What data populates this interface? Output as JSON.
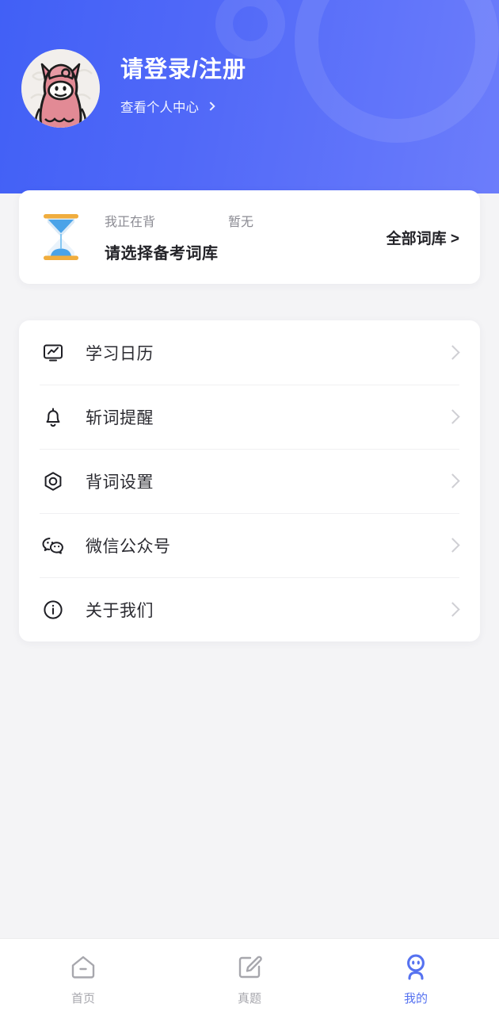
{
  "theme": {
    "header_gradient_from": "#4160f6",
    "header_gradient_to": "#6c7dfb",
    "page_background": "#f4f4f6",
    "card_background": "#ffffff",
    "accent": "#5672f0",
    "muted_text": "#8b8b93",
    "primary_text": "#232328",
    "chevron_grey": "#cfcfd4"
  },
  "header": {
    "avatar_name": "alpaca-avatar",
    "login_title": "请登录/注册",
    "profile_link_label": "查看个人中心",
    "profile_link_chevron": ">"
  },
  "wordbank": {
    "icon_name": "hourglass-icon",
    "status_label": "我正在背",
    "status_value": "暂无",
    "title": "请选择备考词库",
    "all_label": "全部词库 >"
  },
  "menu": {
    "items": [
      {
        "icon": "study-calendar-icon",
        "label": "学习日历",
        "chevron": ">"
      },
      {
        "icon": "bell-icon",
        "label": "斩词提醒",
        "chevron": ">"
      },
      {
        "icon": "settings-hex-icon",
        "label": "背词设置",
        "chevron": ">"
      },
      {
        "icon": "wechat-icon",
        "label": "微信公众号",
        "chevron": ">"
      },
      {
        "icon": "info-icon",
        "label": "关于我们",
        "chevron": ">"
      }
    ]
  },
  "tabbar": {
    "tabs": [
      {
        "icon": "home-icon",
        "label": "首页",
        "active": false
      },
      {
        "icon": "edit-square-icon",
        "label": "真题",
        "active": false
      },
      {
        "icon": "person-icon",
        "label": "我的",
        "active": true
      }
    ]
  }
}
